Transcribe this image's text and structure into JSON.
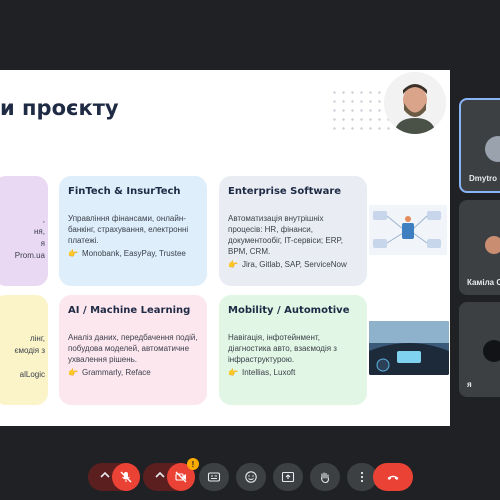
{
  "slide": {
    "title": "и проєкту",
    "cards": {
      "left1": {
        "lines": [
          ",",
          "ня,",
          "я",
          "Prom.ua"
        ]
      },
      "left2": {
        "lines": [
          "лінг,",
          "ємодія з",
          "",
          "alLogic"
        ]
      },
      "fintech": {
        "title": "FinTech & InsurTech",
        "desc": "Управління фінансами, онлайн-банкінг, страхування, електронні платежі.",
        "examples": "Monobank, EasyPay, Trustee"
      },
      "ai": {
        "title": "AI / Machine Learning",
        "desc": "Аналіз даних, передбачення подій, побудова моделей, автоматичне ухвалення рішень.",
        "examples": "Grammarly, Reface"
      },
      "enterprise": {
        "title": "Enterprise Software",
        "desc": "Автоматизація внутрішніх процесів: HR, фінанси, документообіг, IT-сервіси; ERP, BPM, CRM.",
        "examples": "Jira, Gitlab, SAP, ServiceNow"
      },
      "mobility": {
        "title": "Mobility / Automotive",
        "desc": "Навігація, інфотейнмент, діагностика авто, взаємодія з інфраструктурою.",
        "examples": "Intellias, Luxoft"
      }
    }
  },
  "participants": [
    {
      "name": "Dmytro",
      "icon": "avatar-dmytro"
    },
    {
      "name": "Каміла С",
      "icon": "avatar-kamila"
    },
    {
      "name": "я",
      "icon": "avatar-self"
    }
  ],
  "controls": {
    "camera_badge": "!"
  }
}
